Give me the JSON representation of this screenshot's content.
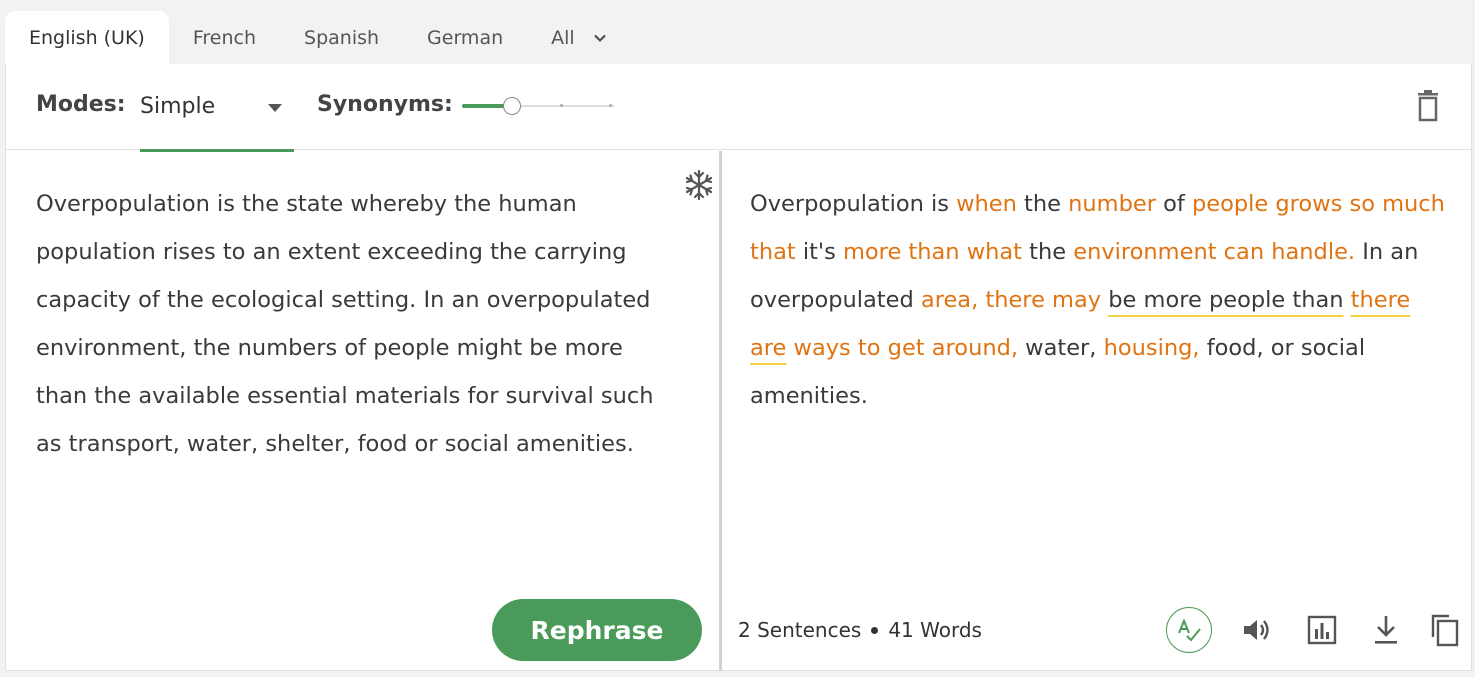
{
  "tabs": {
    "english": "English (UK)",
    "french": "French",
    "spanish": "Spanish",
    "german": "German",
    "all": "All"
  },
  "toolbar": {
    "modes_label": "Modes:",
    "mode_value": "Simple",
    "synonyms_label": "Synonyms:",
    "synonyms_level": 0.33
  },
  "input": {
    "text": "Overpopulation is the state whereby the human population rises to an extent exceeding the carrying capacity of the ecological setting. In an overpopulated environment, the numbers of people might be more than the available essential materials for survival such as transport, water, shelter, food or social amenities."
  },
  "output": {
    "segments": [
      {
        "t": "Overpopulation is "
      },
      {
        "t": "when",
        "s": "changed"
      },
      {
        "t": " the "
      },
      {
        "t": "number",
        "s": "changed"
      },
      {
        "t": " of "
      },
      {
        "t": "people grows so much that",
        "s": "changed"
      },
      {
        "t": " it's "
      },
      {
        "t": "more than what",
        "s": "changed"
      },
      {
        "t": " the "
      },
      {
        "t": "environment can handle.",
        "s": "changed"
      },
      {
        "t": " In an overpopulated "
      },
      {
        "t": "area, there may",
        "s": "changed"
      },
      {
        "t": " "
      },
      {
        "t": "be more people than",
        "s": "underline"
      },
      {
        "t": " "
      },
      {
        "t": "there are",
        "s": "changed-underline"
      },
      {
        "t": " "
      },
      {
        "t": "ways to get around,",
        "s": "changed"
      },
      {
        "t": " water, "
      },
      {
        "t": "housing,",
        "s": "changed"
      },
      {
        "t": " food, or social amenities."
      }
    ]
  },
  "actions": {
    "rephrase_label": "Rephrase"
  },
  "stats": {
    "sentences": "2 Sentences",
    "words": "41 Words"
  },
  "icons": {
    "freeze": "freeze-icon",
    "trash": "trash-icon",
    "grammar": "spellcheck-icon",
    "speaker": "speaker-icon",
    "stats": "bar-chart-icon",
    "download": "download-icon",
    "copy": "copy-icon"
  },
  "colors": {
    "accent": "#4a9b5a",
    "changed": "#e07412",
    "underline": "#f3d03e"
  }
}
